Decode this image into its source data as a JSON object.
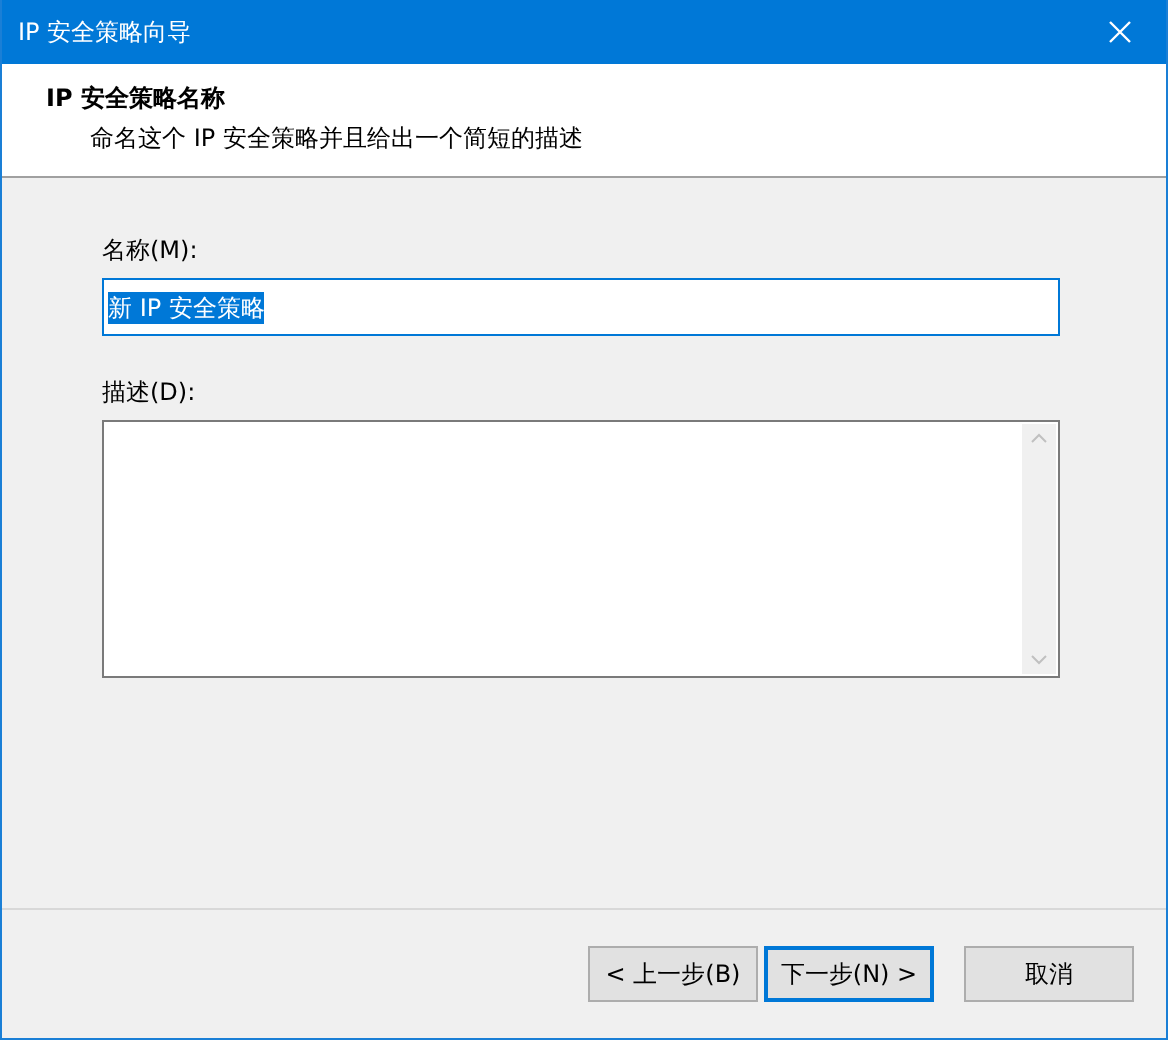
{
  "window": {
    "title": "IP 安全策略向导"
  },
  "header": {
    "title": "IP 安全策略名称",
    "subtitle": "命名这个 IP 安全策略并且给出一个简短的描述"
  },
  "name_field": {
    "label": "名称(M):",
    "value": "新 IP 安全策略",
    "text_selected": true
  },
  "description_field": {
    "label": "描述(D):"
  },
  "buttons": [
    {
      "label": "< 上一步(B)",
      "default": false
    },
    {
      "label": "下一步(N) >",
      "default": true
    },
    {
      "label": "取消",
      "default": false
    }
  ]
}
